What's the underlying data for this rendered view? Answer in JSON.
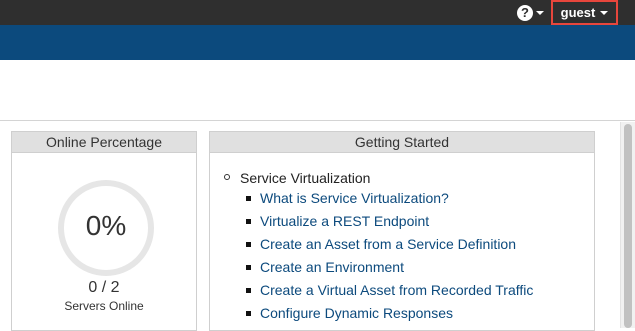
{
  "topbar": {
    "help_icon": "help-circle-icon",
    "help_glyph": "?",
    "user_label": "guest"
  },
  "online_panel": {
    "title": "Online Percentage",
    "percent": "0%",
    "percent_value": 0,
    "count": "0 / 2",
    "count_label": "Servers Online"
  },
  "getting_started": {
    "title": "Getting Started",
    "section": "Service Virtualization",
    "links": [
      "What is Service Virtualization?",
      "Virtualize a REST Endpoint",
      "Create an Asset from a Service Definition",
      "Create an Environment",
      "Create a Virtual Asset from Recorded Traffic",
      "Configure Dynamic Responses"
    ]
  },
  "colors": {
    "topbar": "#2f2f2f",
    "brand_blue": "#0c4a7d",
    "highlight": "#e8463c",
    "ring": "#e6e6e6"
  }
}
